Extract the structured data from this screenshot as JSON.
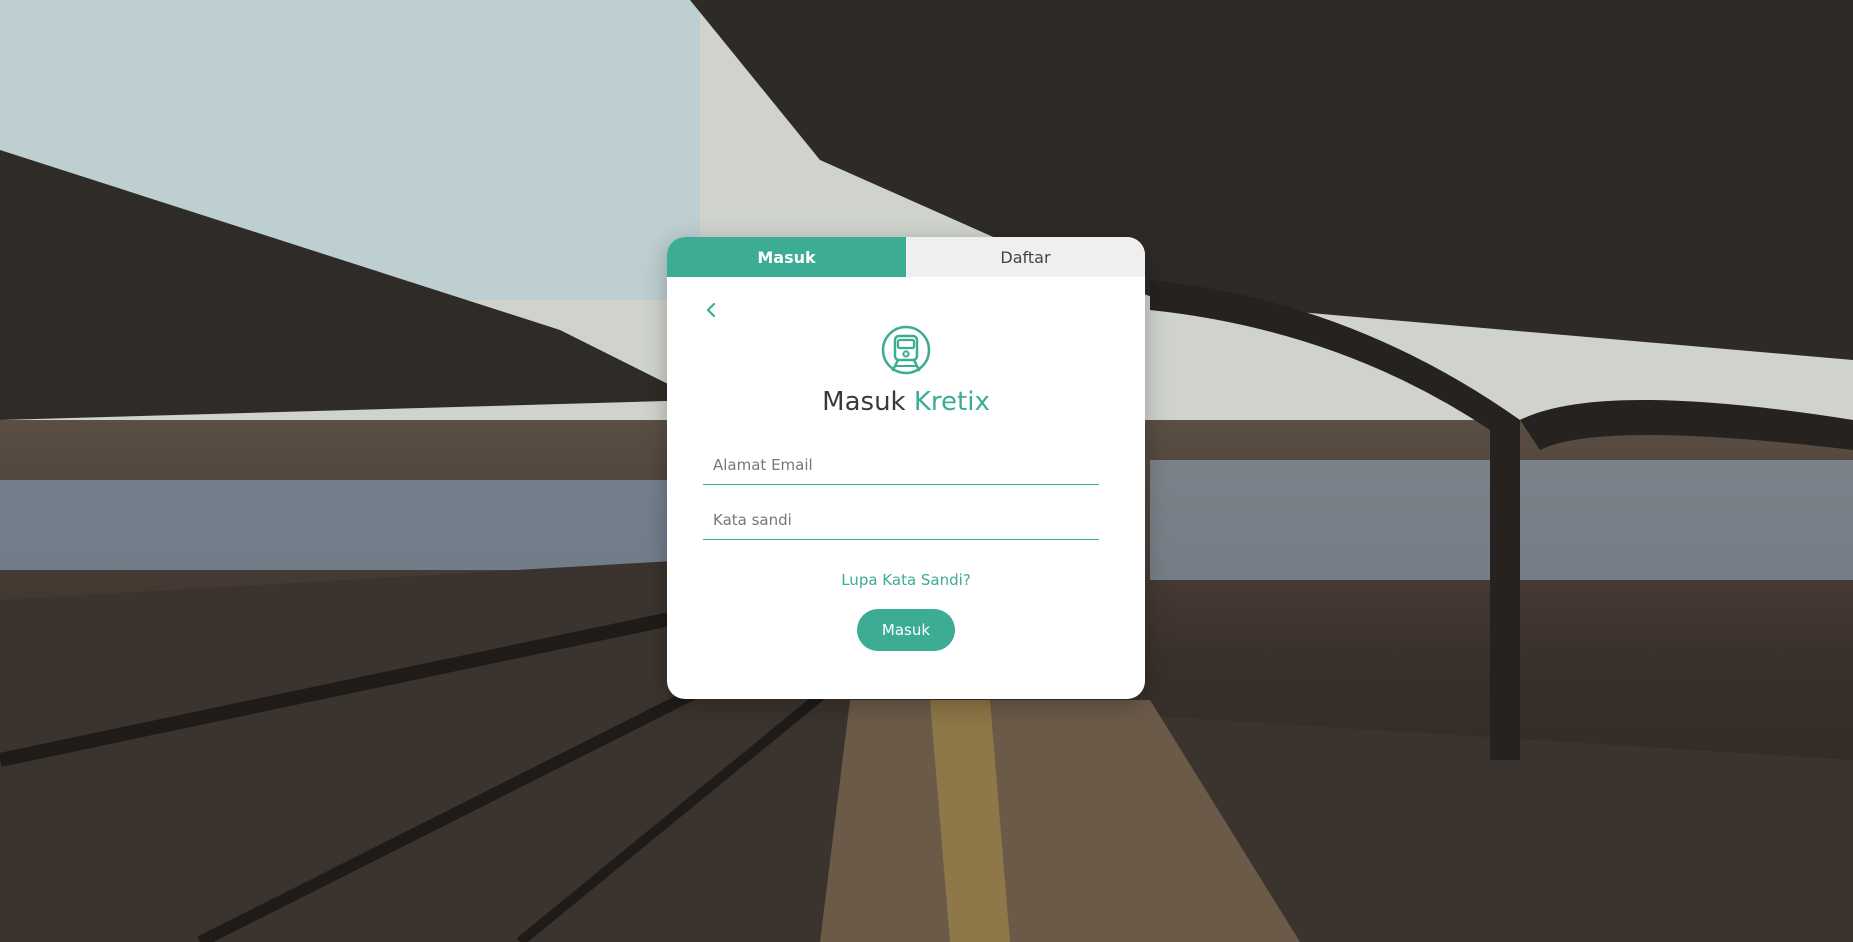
{
  "tabs": {
    "login": "Masuk",
    "register": "Daftar"
  },
  "heading": {
    "prefix": "Masuk",
    "brand": "Kretix"
  },
  "form": {
    "email_placeholder": "Alamat Email",
    "password_placeholder": "Kata sandi",
    "forgot_label": "Lupa Kata Sandi?",
    "submit_label": "Masuk"
  },
  "icons": {
    "back": "chevron-left-icon",
    "logo": "train-icon"
  },
  "colors": {
    "accent": "#3dac95",
    "tab_inactive": "#efefef",
    "card": "#ffffff"
  }
}
